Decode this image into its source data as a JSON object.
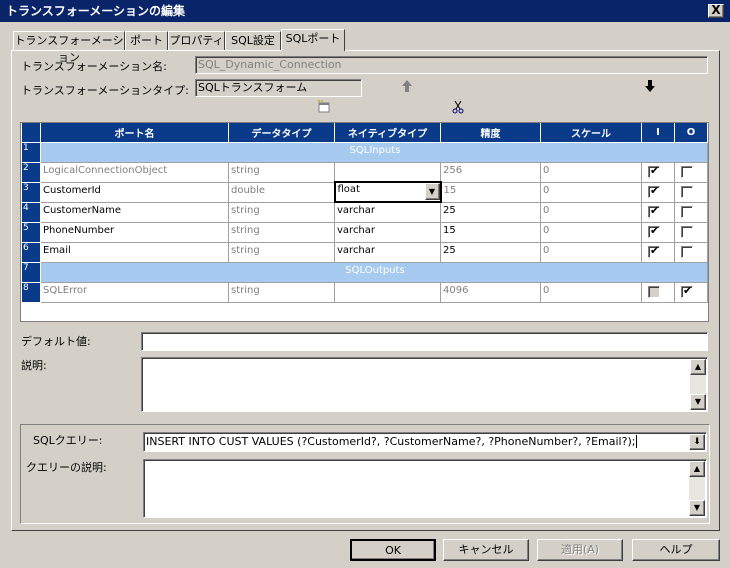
{
  "window": {
    "title": "トランスフォーメーションの編集",
    "close": "X"
  },
  "tabs": [
    "トランスフォーメーション",
    "ポート",
    "プロパティ",
    "SQL設定",
    "SQLポート"
  ],
  "header": {
    "name_label": "トランスフォーメーション名:",
    "name_value": "SQL_Dynamic_Connection",
    "type_label": "トランスフォーメーションタイプ:",
    "type_value": "SQLトランスフォーム"
  },
  "grid": {
    "columns": [
      "ポート名",
      "データタイプ",
      "ネイティブタイプ",
      "精度",
      "スケール",
      "I",
      "O"
    ],
    "rows": [
      {
        "num": "1",
        "section": "SQLInputs"
      },
      {
        "num": "2",
        "name": "LogicalConnectionObject",
        "dtype": "string",
        "ntype": "",
        "prec": "256",
        "scale": "0",
        "i": true,
        "o": false,
        "grey": true
      },
      {
        "num": "3",
        "name": "CustomerId",
        "dtype": "double",
        "ntype": "float",
        "prec": "15",
        "scale": "0",
        "i": true,
        "o": false,
        "dropdown": true
      },
      {
        "num": "4",
        "name": "CustomerName",
        "dtype": "string",
        "ntype": "varchar",
        "prec": "25",
        "scale": "0",
        "i": true,
        "o": false
      },
      {
        "num": "5",
        "name": "PhoneNumber",
        "dtype": "string",
        "ntype": "varchar",
        "prec": "15",
        "scale": "0",
        "i": true,
        "o": false
      },
      {
        "num": "6",
        "name": "Email",
        "dtype": "string",
        "ntype": "varchar",
        "prec": "25",
        "scale": "0",
        "i": true,
        "o": false
      },
      {
        "num": "7",
        "section": "SQLOutputs"
      },
      {
        "num": "8",
        "name": "SQLError",
        "dtype": "string",
        "ntype": "",
        "prec": "4096",
        "scale": "0",
        "i": false,
        "o": true,
        "grey": true,
        "idis": true
      }
    ]
  },
  "default_label": "デフォルト値:",
  "desc_label": "説明:",
  "sql_label": "SQLクエリー:",
  "sql_value": "INSERT INTO CUST VALUES (?CustomerId?, ?CustomerName?, ?PhoneNumber?, ?Email?);",
  "query_desc_label": "クエリーの説明:",
  "buttons": {
    "ok": "OK",
    "cancel": "キャンセル",
    "apply": "適用(A)",
    "help": "ヘルプ"
  }
}
